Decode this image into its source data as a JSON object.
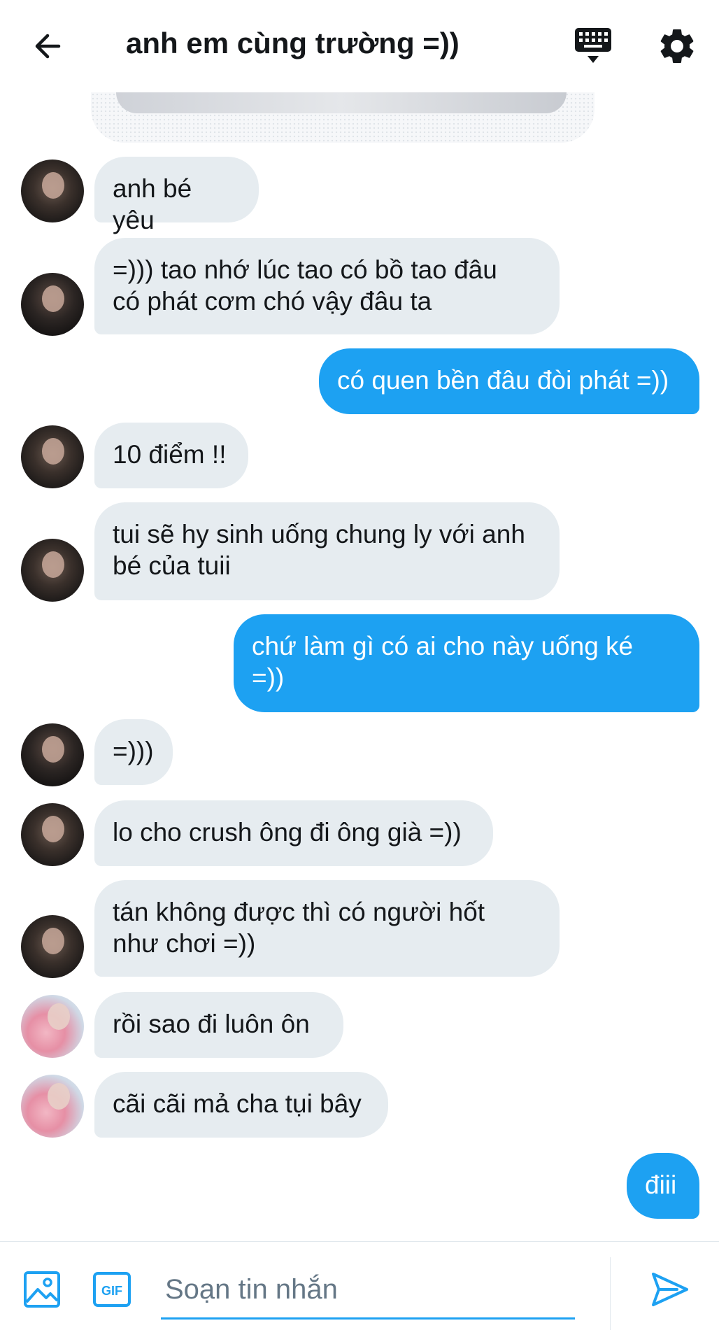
{
  "header": {
    "title": "anh em cùng trường =))",
    "back_icon": "arrow-left-icon",
    "keyboard_icon": "keyboard-icon",
    "settings_icon": "gear-icon"
  },
  "messages": [
    {
      "direction": "in",
      "text": "anh bé yêu",
      "avatar": "dark-haired-boy"
    },
    {
      "direction": "in",
      "text": "=))) tao nhớ lúc tao có bồ tao đâu\ncó phát cơm chó vậy đâu ta",
      "avatar": "dark-shirt-boy"
    },
    {
      "direction": "out",
      "text": "có quen bền đâu đòi phát =))"
    },
    {
      "direction": "in",
      "text": "10 điểm !!",
      "avatar": "dark-haired-boy"
    },
    {
      "direction": "in",
      "text": "tui sẽ hy sinh uống chung ly với anh\nbé của tuii",
      "avatar": "dark-haired-boy"
    },
    {
      "direction": "out",
      "text": "chứ làm gì có ai cho này uống ké\n=))"
    },
    {
      "direction": "in",
      "text": "=)))",
      "avatar": "dark-shirt-boy"
    },
    {
      "direction": "in",
      "text": "lo cho crush ông đi ông già =))",
      "avatar": "dark-haired-boy"
    },
    {
      "direction": "in",
      "text": "tán không được thì có người hốt\nnhư chơi =))",
      "avatar": "dark-haired-boy"
    },
    {
      "direction": "in",
      "text": "rồi sao đi luôn ôn",
      "avatar": "pink-flowers"
    },
    {
      "direction": "in",
      "text": "cãi cãi mả cha tụi bây",
      "avatar": "pink-flowers"
    },
    {
      "direction": "out",
      "text": "điii"
    }
  ],
  "composer": {
    "placeholder": "Soạn tin nhắn",
    "value": "",
    "image_icon": "image-icon",
    "gif_label": "GIF",
    "send_icon": "send-icon"
  },
  "colors": {
    "accent": "#1da1f2",
    "incoming_bubble": "#e6ecf0",
    "text": "#14171a"
  }
}
